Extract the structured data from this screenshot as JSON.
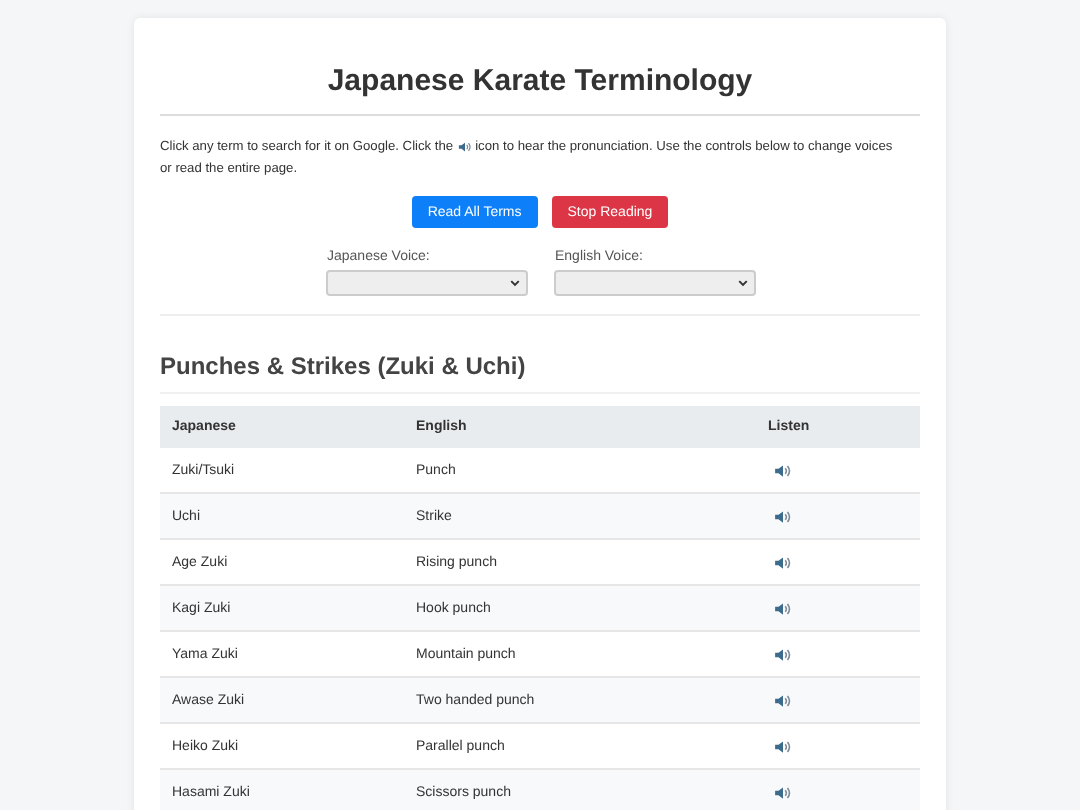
{
  "title": "Japanese Karate Terminology",
  "intro": {
    "before": "Click any term to search for it on Google. Click the",
    "after": "icon to hear the pronunciation. Use the controls below to change voices",
    "line_2": "or read the entire page."
  },
  "buttons": [
    {
      "label": "Read All Terms",
      "kind": "primary"
    },
    {
      "label": "Stop Reading",
      "kind": "danger"
    }
  ],
  "voices": [
    {
      "label": "Japanese Voice:"
    },
    {
      "label": "English Voice:"
    }
  ],
  "section": {
    "heading": "Punches & Strikes (Zuki & Uchi)",
    "columns": [
      "Japanese",
      "English",
      "Listen"
    ],
    "rows": [
      {
        "japanese": "Zuki/Tsuki",
        "english": "Punch"
      },
      {
        "japanese": "Uchi",
        "english": "Strike"
      },
      {
        "japanese": "Age Zuki",
        "english": "Rising punch"
      },
      {
        "japanese": "Kagi Zuki",
        "english": "Hook punch"
      },
      {
        "japanese": "Yama Zuki",
        "english": "Mountain punch"
      },
      {
        "japanese": "Awase Zuki",
        "english": "Two handed punch"
      },
      {
        "japanese": "Heiko Zuki",
        "english": "Parallel punch"
      },
      {
        "japanese": "Hasami Zuki",
        "english": "Scissors punch"
      }
    ]
  }
}
